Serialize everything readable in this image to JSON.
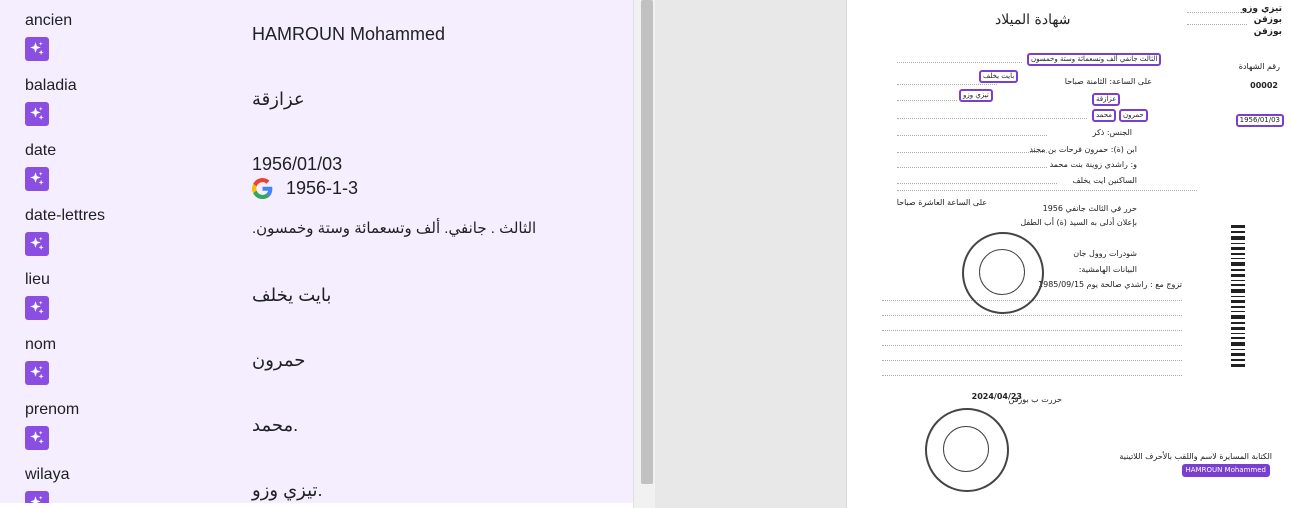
{
  "fields": [
    {
      "key": "ancien",
      "value": "HAMROUN Mohammed"
    },
    {
      "key": "baladia",
      "value": "عزازقة"
    },
    {
      "key": "date",
      "value": "1956/01/03",
      "google_value": "1956-1-3"
    },
    {
      "key": "date-lettres",
      "value": "الثالث . جانفي. ألف وتسعمائة وستة وخمسون."
    },
    {
      "key": "lieu",
      "value": "بايت يخلف"
    },
    {
      "key": "nom",
      "value": "حمرون"
    },
    {
      "key": "prenom",
      "value": "محمد."
    },
    {
      "key": "wilaya",
      "value": "تيزي وزو."
    }
  ],
  "icons": {
    "field_action": "sparkle-icon",
    "google": "google-logo-icon"
  },
  "colors": {
    "panel_bg": "#f4eefe",
    "accent": "#8a4fe0",
    "highlight": "#7a3fd0"
  },
  "document": {
    "title": "شهادة الميلاد",
    "wilaya_line": "تيزي وزو",
    "daira_line": "بوزقن",
    "baladia_line": "بوزقن",
    "cert_label": "رقم الشهادة",
    "cert_number": "00002",
    "date_words": "الثالث جانفي ألف وتسعمائة وستة وخمسون",
    "time_line": "على الساعة: الثامنة صباحا",
    "lieu": "بايت يخلف",
    "baladia": "عزازقة",
    "wilaya": "تيزي وزو",
    "nom": "حمرون",
    "prenom": "محمد",
    "date": "1956/01/03",
    "sexe": "الجنس: ذكر",
    "father": "ابن (ة): حمرون فرحات بن محند",
    "mother": "و: راشدي زوينة بنت محمد",
    "residence": "الساكنين ايت يخلف",
    "recorded": "حرر في الثالث جانفي 1956",
    "recorded_time": "على الساعة العاشرة صباحا",
    "declarant": "بإعلان أدلى به السيد (ة) أب الطفل",
    "officer": "شودرات روول جان",
    "marginal": "البيانات الهامشية:",
    "marriage": "تزوج مع : راشدي صالحة يوم 1985/09/15",
    "issued_place": "حررت ب بوزقن",
    "issued_date": "2024/04/23",
    "latin_label": "الكتابة المسايرة لاسم واللقب بالأحرف اللاتينية",
    "latin_name": "HAMROUN Mohammed"
  }
}
